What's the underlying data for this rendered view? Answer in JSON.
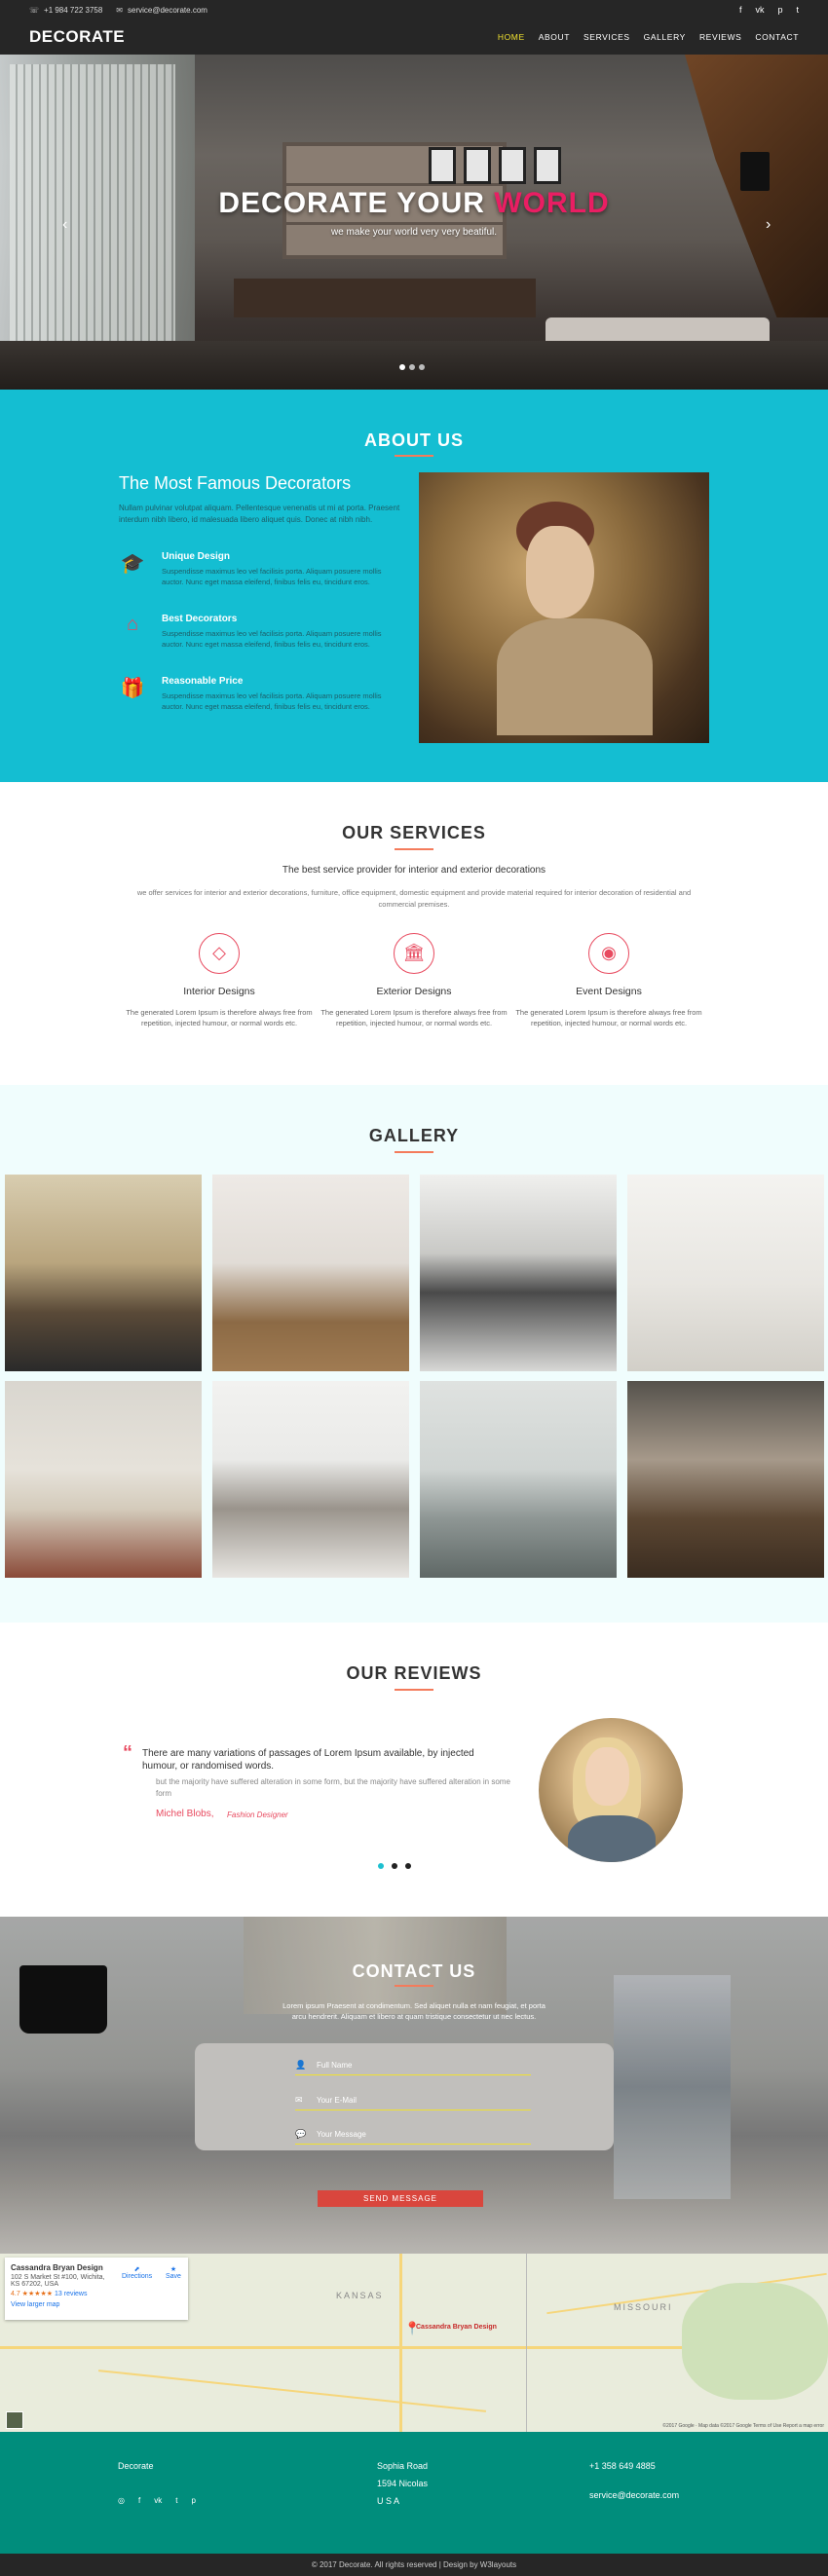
{
  "topbar": {
    "phone": "+1 984 722 3758",
    "email": "service@decorate.com",
    "social": [
      "f",
      "vk",
      "p",
      "t"
    ]
  },
  "nav": {
    "logo": "DECORATE",
    "items": [
      {
        "label": "HOME",
        "active": true
      },
      {
        "label": "ABOUT"
      },
      {
        "label": "SERVICES"
      },
      {
        "label": "GALLERY"
      },
      {
        "label": "REVIEWS"
      },
      {
        "label": "CONTACT"
      }
    ]
  },
  "hero": {
    "title_main": "DECORATE YOUR ",
    "title_accent": "WORLD",
    "subtitle": "we make your world very very beatiful.",
    "slide_count": 3,
    "active_slide": 0
  },
  "about": {
    "title": "ABOUT US",
    "heading": "The Most Famous Decorators",
    "intro": "Nullam pulvinar volutpat aliquam. Pellentesque venenatis ut mi at porta. Praesent interdum nibh libero, id malesuada libero aliquet quis. Donec at nibh nibh.",
    "features": [
      {
        "icon": "graduation-cap-icon",
        "title": "Unique Design",
        "text": "Suspendisse maximus leo vel facilisis porta. Aliquam posuere mollis auctor. Nunc eget massa eleifend, finibus felis eu, tincidunt eros."
      },
      {
        "icon": "home-icon",
        "title": "Best Decorators",
        "text": "Suspendisse maximus leo vel facilisis porta. Aliquam posuere mollis auctor. Nunc eget massa eleifend, finibus felis eu, tincidunt eros."
      },
      {
        "icon": "gift-icon",
        "title": "Reasonable Price",
        "text": "Suspendisse maximus leo vel facilisis porta. Aliquam posuere mollis auctor. Nunc eget massa eleifend, finibus felis eu, tincidunt eros."
      }
    ]
  },
  "services": {
    "title": "OUR SERVICES",
    "lead": "The best service provider for interior and exterior decorations",
    "desc": "we offer services for interior and exterior decorations, furniture, office equipment, domestic equipment and provide material required for interior decoration of residential and commercial premises.",
    "items": [
      {
        "icon": "diamond-icon",
        "title": "Interior Designs",
        "text": "The generated Lorem Ipsum is therefore always free from repetition, injected humour, or normal words etc."
      },
      {
        "icon": "bank-icon",
        "title": "Exterior Designs",
        "text": "The generated Lorem Ipsum is therefore always free from repetition, injected humour, or normal words etc."
      },
      {
        "icon": "weibo-icon",
        "title": "Event Designs",
        "text": "The generated Lorem Ipsum is therefore always free from repetition, injected humour, or normal words etc."
      }
    ]
  },
  "gallery": {
    "title": "GALLERY",
    "images": [
      "bedroom",
      "home-office",
      "living-room-gray",
      "white-living-room",
      "cream-sofa-room",
      "tufted-sofa-room",
      "lamp-living-room",
      "kitchen-island"
    ]
  },
  "reviews": {
    "title": "OUR REVIEWS",
    "quote": "There are many variations of passages of Lorem Ipsum available, by injected humour, or randomised words.",
    "sub": "but the majority have suffered alteration in some form, but the majority have suffered alteration in some form",
    "name": "Michel Blobs,",
    "role": "Fashion Designer",
    "dots": 3,
    "active_dot": 0
  },
  "contact": {
    "title": "CONTACT US",
    "desc": "Lorem ipsum Praesent at condimentum. Sed aliquet nulla et nam feugiat, et porta arcu hendrerit. Aliquam et libero at quam tristique consectetur ut nec lectus.",
    "name_placeholder": "Full Name",
    "email_placeholder": "Your E-Mail",
    "message_placeholder": "Your Message",
    "button": "SEND MESSAGE"
  },
  "map": {
    "place": "Cassandra Bryan Design",
    "address": "102 S Market St #100, Wichita, KS 67202, USA",
    "rating": "4.7 ★★★★★",
    "reviews": "13 reviews",
    "directions": "Directions",
    "save": "Save",
    "larger": "View larger map",
    "states": [
      "KANSAS",
      "MISSOURI"
    ],
    "pin_label": "Cassandra Bryan Design",
    "attribution": "©2017 Google · Map data ©2017 Google   Terms of Use   Report a map error"
  },
  "footer": {
    "brand": "Decorate",
    "address": [
      "Sophia Road",
      "1594 Nicolas",
      "U S A"
    ],
    "phone": "+1 358 649 4885",
    "email": "service@decorate.com",
    "social": [
      "◎",
      "f",
      "vk",
      "p",
      "t"
    ]
  },
  "copyright": "© 2017 Decorate. All rights reserved | Design by W3layouts"
}
